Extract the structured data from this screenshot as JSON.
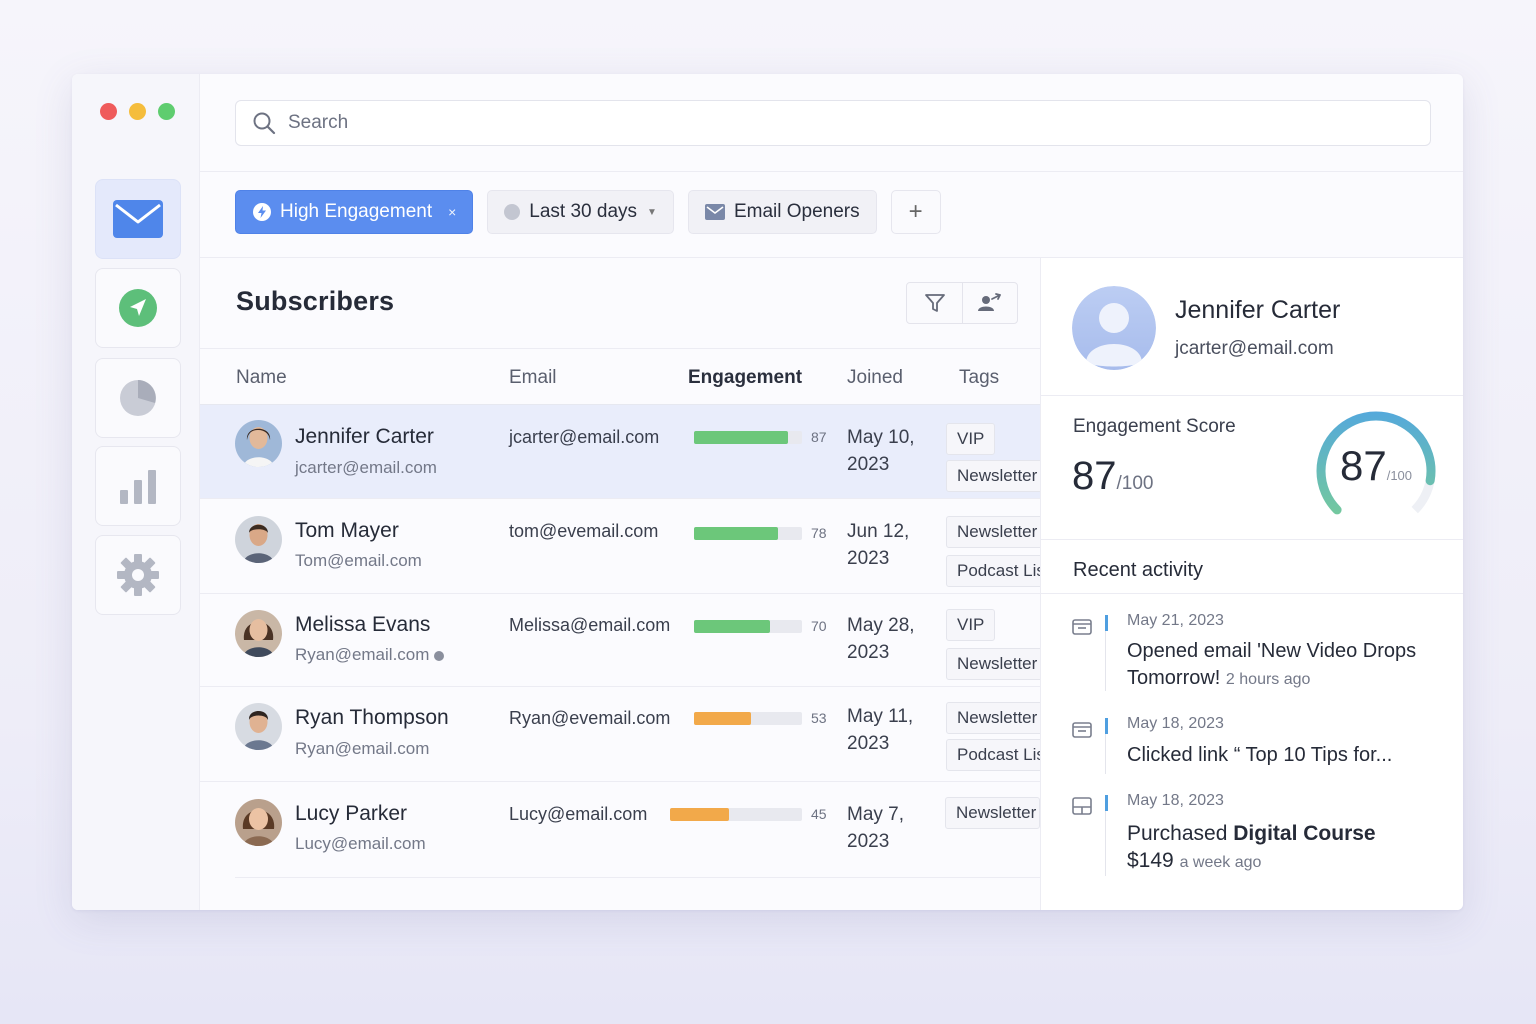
{
  "search": {
    "placeholder": "Search"
  },
  "filters": {
    "high_engagement": "High Engagement",
    "remove": "×",
    "date_range": "Last 30 days",
    "email_openers": "Email Openers",
    "add": "+"
  },
  "main": {
    "title": "Subscribers",
    "columns": {
      "name": "Name",
      "email": "Email",
      "engagement": "Engagement",
      "joined": "Joined",
      "tags": "Tags"
    },
    "rows": [
      {
        "name": "Jennifer Carter",
        "sub_email": "jcarter@email.com",
        "email": "jcarter@email.com",
        "score": 87,
        "score_label": "87",
        "joined_1": "May 10,",
        "joined_2": "2023",
        "tag_1": "VIP",
        "tag_2": "Newsletter"
      },
      {
        "name": "Tom Mayer",
        "sub_email": "Tom@email.com",
        "email": "tom@evemail.com",
        "score": 78,
        "score_label": "78",
        "joined_1": "Jun 12,",
        "joined_2": "2023",
        "tag_1": "Newsletter",
        "tag_2": "Podcast Listener"
      },
      {
        "name": "Melissa Evans",
        "sub_email": "Ryan@email.com",
        "email": "Melissa@email.com",
        "score": 70,
        "score_label": "70",
        "joined_1": "May 28,",
        "joined_2": "2023",
        "tag_1": "VIP",
        "tag_2": "Newsletter"
      },
      {
        "name": "Ryan Thompson",
        "sub_email": "Ryan@email.com",
        "email": "Ryan@evemail.com",
        "score": 53,
        "score_label": "53",
        "joined_1": "May 11,",
        "joined_2": "2023",
        "tag_1": "Newsletter",
        "tag_2": "Podcast Listener"
      },
      {
        "name": "Lucy Parker",
        "sub_email": "Lucy@email.com",
        "email": "Lucy@email.com",
        "score": 45,
        "score_label": "45",
        "joined_1": "May 7,",
        "joined_2": "2023",
        "tag_1": "Newsletter"
      }
    ]
  },
  "panel": {
    "name": "Jennifer Carter",
    "email": "jcarter@email.com",
    "engagement_label": "Engagement Score",
    "score": "87",
    "score_max": "/100",
    "score_value": 87,
    "recent_label": "Recent activity",
    "activities": [
      {
        "date": "May 21, 2023",
        "text": "Opened email 'New Video Drops Tomorrow!",
        "ago": "2 hours ago"
      },
      {
        "date": "May 18, 2023",
        "text": "Clicked link “ Top 10 Tips for..."
      },
      {
        "date": "May 18, 2023",
        "text_1": "Purchased",
        "text_2": "Digital Course",
        "price": "$149",
        "ago": "a week ago"
      }
    ]
  },
  "colors": {
    "accent": "#5b8def",
    "green": "#6cc77a",
    "orange": "#f2a94a",
    "gauge_start": "#4fa3e6",
    "gauge_end": "#7ed38a"
  }
}
